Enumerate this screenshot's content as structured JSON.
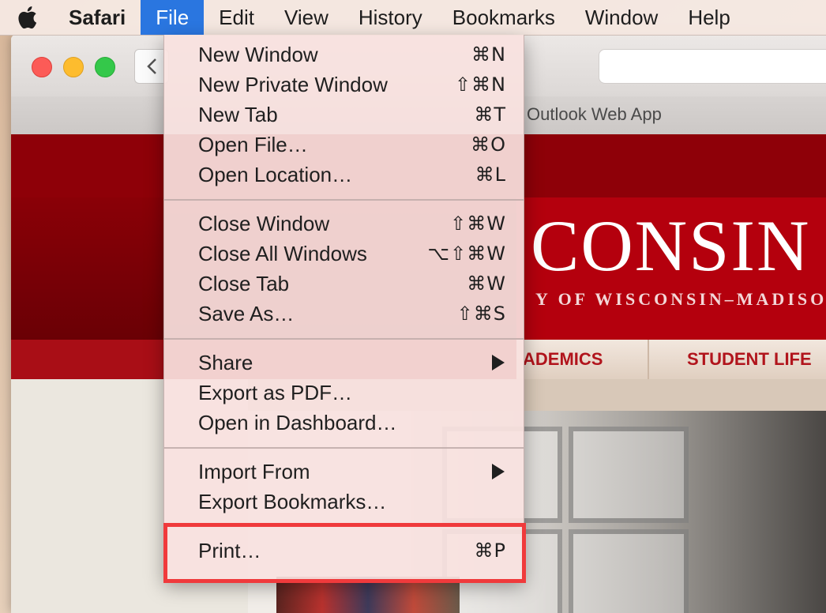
{
  "menubar": {
    "apple_icon": "apple-icon",
    "items": [
      {
        "label": "Safari",
        "bold": true
      },
      {
        "label": "File",
        "active": true
      },
      {
        "label": "Edit"
      },
      {
        "label": "View"
      },
      {
        "label": "History"
      },
      {
        "label": "Bookmarks"
      },
      {
        "label": "Window"
      },
      {
        "label": "Help"
      }
    ]
  },
  "window": {
    "favorites_link": "Outlook Web App"
  },
  "page": {
    "wordmark": "CONSIN",
    "tagline": "Y OF WISCONSIN–MADISO",
    "nav": [
      "ADEMICS",
      "STUDENT LIFE"
    ]
  },
  "file_menu": {
    "groups": [
      [
        {
          "label": "New Window",
          "shortcut": "⌘N"
        },
        {
          "label": "New Private Window",
          "shortcut": "⇧⌘N"
        },
        {
          "label": "New Tab",
          "shortcut": "⌘T"
        },
        {
          "label": "Open File…",
          "shortcut": "⌘O"
        },
        {
          "label": "Open Location…",
          "shortcut": "⌘L"
        }
      ],
      [
        {
          "label": "Close Window",
          "shortcut": "⇧⌘W"
        },
        {
          "label": "Close All Windows",
          "shortcut": "⌥⇧⌘W"
        },
        {
          "label": "Close Tab",
          "shortcut": "⌘W"
        },
        {
          "label": "Save As…",
          "shortcut": "⇧⌘S"
        }
      ],
      [
        {
          "label": "Share",
          "submenu": true
        },
        {
          "label": "Export as PDF…"
        },
        {
          "label": "Open in Dashboard…"
        }
      ],
      [
        {
          "label": "Import From",
          "submenu": true
        },
        {
          "label": "Export Bookmarks…"
        }
      ],
      [
        {
          "label": "Print…",
          "shortcut": "⌘P",
          "highlighted": true
        }
      ]
    ]
  },
  "colors": {
    "menu_active": "#2a76e0",
    "highlight_border": "#f03a3c",
    "uw_red": "#b4000d"
  }
}
